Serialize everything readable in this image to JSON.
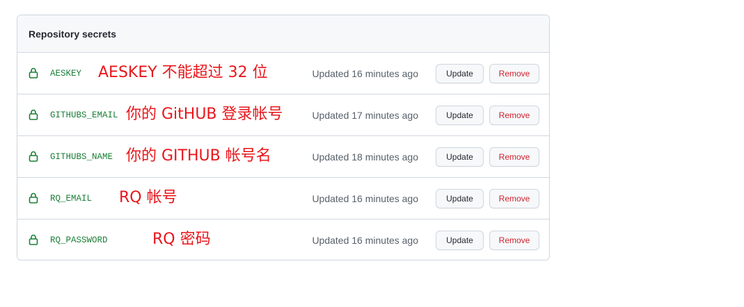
{
  "header": {
    "title": "Repository secrets"
  },
  "secrets": [
    {
      "name": "AESKEY",
      "note": "AESKEY 不能超过 32 位",
      "updated": "Updated 16 minutes ago"
    },
    {
      "name": "GITHUBS_EMAIL",
      "note": "你的 GitHUB 登录帐号",
      "updated": "Updated 17 minutes ago"
    },
    {
      "name": "GITHUBS_NAME",
      "note": "你的 GITHUB 帐号名",
      "updated": "Updated 18 minutes ago"
    },
    {
      "name": "RQ_EMAIL",
      "note": "RQ 帐号",
      "updated": "Updated 16 minutes ago"
    },
    {
      "name": "RQ_PASSWORD",
      "note": "RQ 密码",
      "updated": "Updated 16 minutes ago"
    }
  ],
  "actions": {
    "update_label": "Update",
    "remove_label": "Remove"
  },
  "icons": {
    "row_icon": "lock-icon"
  },
  "colors": {
    "secret_name": "#1a7f37",
    "annotation": "#e8161b",
    "remove_text": "#cf222e",
    "border": "#d0d7de",
    "header_bg": "#f6f8fa"
  }
}
